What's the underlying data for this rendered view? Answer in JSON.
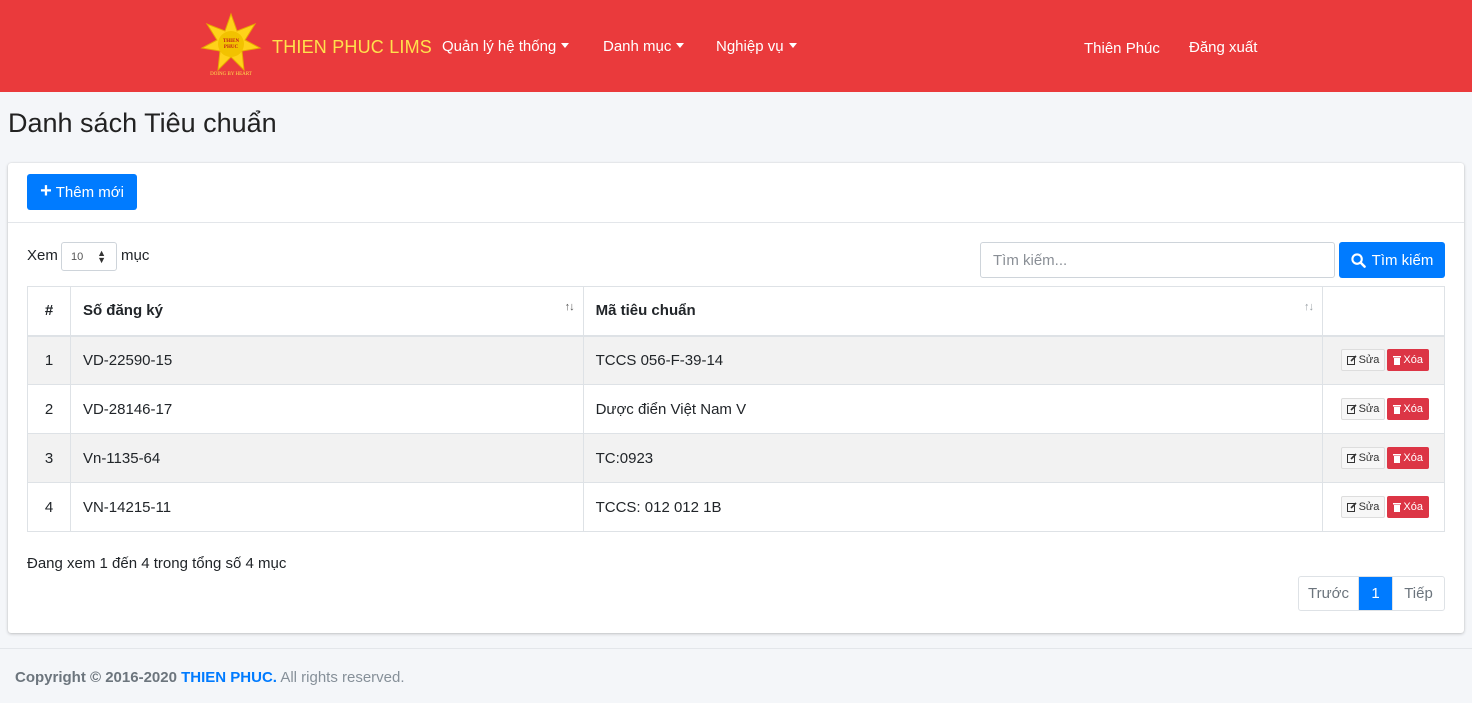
{
  "navbar": {
    "brand": "THIEN PHUC LIMS",
    "logo_text_top": "THIEN",
    "logo_text_bottom": "PHUC",
    "logo_slogan": "DOING BY HEART",
    "menu": [
      {
        "label": "Quản lý hệ thống"
      },
      {
        "label": "Danh mục"
      },
      {
        "label": "Nghiệp vụ"
      }
    ],
    "user": "Thiên Phúc",
    "logout": "Đăng xuất",
    "colors": {
      "bar": "#ea3a3c",
      "brand": "#ffe14d"
    }
  },
  "page": {
    "title": "Danh sách Tiêu chuẩn"
  },
  "toolbar": {
    "add_label": "Thêm mới",
    "show_prefix": "Xem",
    "page_length": "10",
    "show_suffix": "mục",
    "search_placeholder": "Tìm kiếm...",
    "search_label": "Tìm kiếm"
  },
  "table": {
    "headers": [
      "#",
      "Số đăng ký",
      "Mã tiêu chuẩn",
      ""
    ],
    "edit_label": "Sửa",
    "delete_label": "Xóa",
    "rows": [
      {
        "idx": "1",
        "reg": "VD-22590-15",
        "code": "TCCS 056-F-39-14"
      },
      {
        "idx": "2",
        "reg": "VD-28146-17",
        "code": "Dược điển Việt Nam V"
      },
      {
        "idx": "3",
        "reg": "Vn-1135-64",
        "code": "TC:0923"
      },
      {
        "idx": "4",
        "reg": "VN-14215-11",
        "code": "TCCS: 012 012 1B"
      }
    ]
  },
  "footer_info": "Đang xem 1 đến 4 trong tổng số 4 mục",
  "pagination": {
    "prev": "Trước",
    "current": "1",
    "next": "Tiếp"
  },
  "footer": {
    "copyright": "Copyright © 2016-2020",
    "company": "THIEN PHUC.",
    "rights": "All rights reserved."
  },
  "accent_color": "#007bff"
}
